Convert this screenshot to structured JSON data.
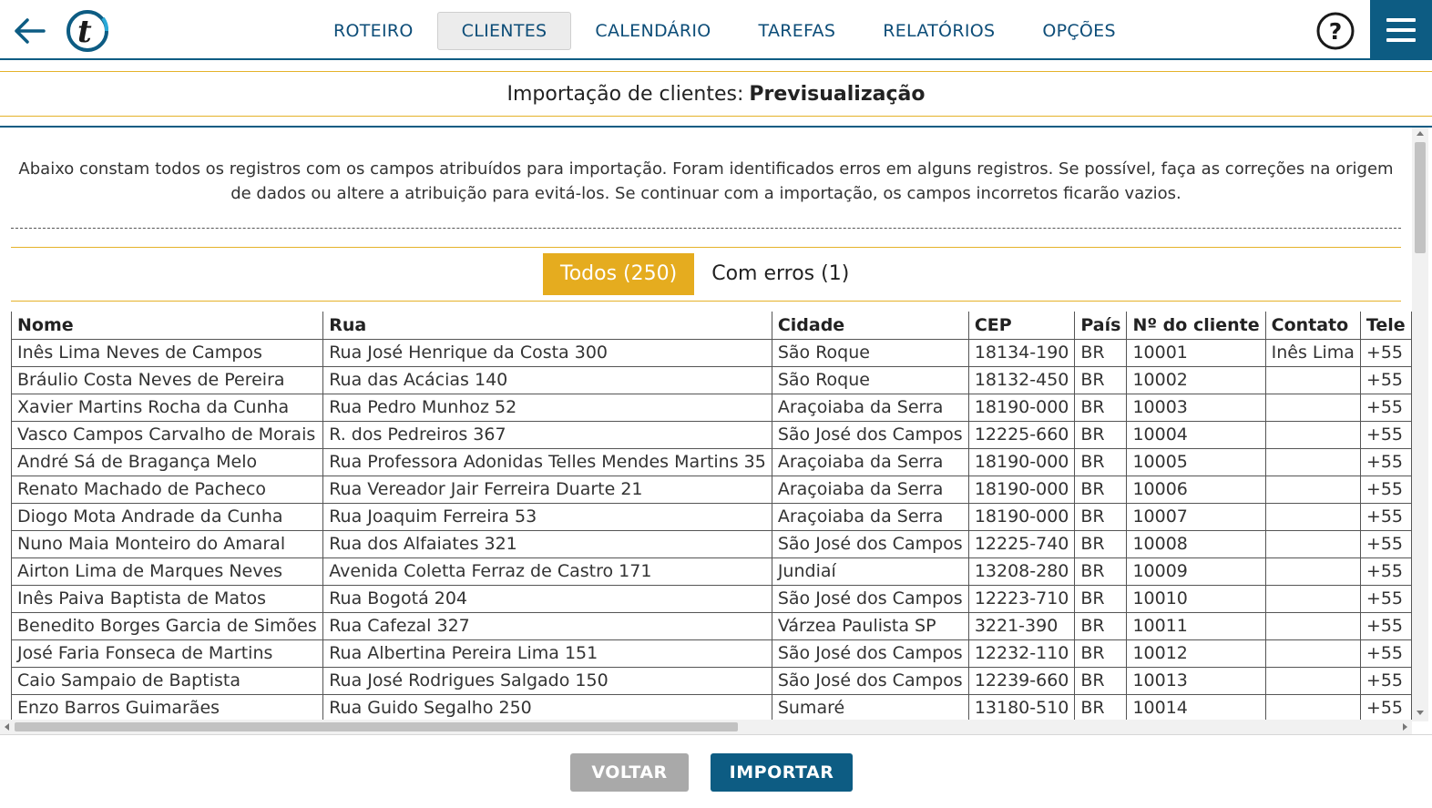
{
  "nav": {
    "back_icon": "arrow-left-icon",
    "logo_letter": "t",
    "items": [
      {
        "label": "ROTEIRO",
        "active": false
      },
      {
        "label": "CLIENTES",
        "active": true
      },
      {
        "label": "CALENDÁRIO",
        "active": false
      },
      {
        "label": "TAREFAS",
        "active": false
      },
      {
        "label": "RELATÓRIOS",
        "active": false
      },
      {
        "label": "OPÇÕES",
        "active": false
      }
    ],
    "help_label": "?",
    "menu_icon": "hamburger-menu-icon"
  },
  "page": {
    "title_prefix": "Importação de clientes:",
    "title_bold": "Previsualização",
    "intro": "Abaixo constam todos os registros com os campos atribuídos para importação. Foram identificados erros em alguns registros. Se possível, faça as correções na origem de dados ou altere a atribuição para evitá-los. Se continuar com a importação, os campos incorretos ficarão vazios."
  },
  "filters": {
    "all_label": "Todos (250)",
    "errors_label": "Com erros (1)"
  },
  "table": {
    "columns": [
      "Nome",
      "Rua",
      "Cidade",
      "CEP",
      "País",
      "Nº do cliente",
      "Contato",
      "Tele"
    ],
    "rows": [
      [
        "Inês Lima Neves de Campos",
        "Rua José Henrique da Costa 300",
        "São Roque",
        "18134-190",
        "BR",
        "10001",
        "Inês Lima",
        "+55"
      ],
      [
        "Bráulio Costa Neves de Pereira",
        "Rua das Acácias 140",
        "São Roque",
        "18132-450",
        "BR",
        "10002",
        "",
        "+55"
      ],
      [
        "Xavier Martins Rocha da Cunha",
        "Rua Pedro Munhoz 52",
        "Araçoiaba da Serra",
        "18190-000",
        "BR",
        "10003",
        "",
        "+55"
      ],
      [
        "Vasco Campos Carvalho de Morais",
        "R. dos Pedreiros 367",
        "São José dos Campos",
        "12225-660",
        "BR",
        "10004",
        "",
        "+55"
      ],
      [
        "André Sá de Bragança Melo",
        "Rua Professora Adonidas Telles Mendes Martins 35",
        "Araçoiaba da Serra",
        "18190-000",
        "BR",
        "10005",
        "",
        "+55"
      ],
      [
        "Renato Machado de Pacheco",
        "Rua Vereador Jair Ferreira Duarte 21",
        "Araçoiaba da Serra",
        "18190-000",
        "BR",
        "10006",
        "",
        "+55"
      ],
      [
        "Diogo Mota Andrade da Cunha",
        "Rua Joaquim Ferreira 53",
        "Araçoiaba da Serra",
        "18190-000",
        "BR",
        "10007",
        "",
        "+55"
      ],
      [
        "Nuno Maia Monteiro do Amaral",
        "Rua dos Alfaiates 321",
        "São José dos Campos",
        "12225-740",
        "BR",
        "10008",
        "",
        "+55"
      ],
      [
        "Airton Lima de Marques Neves",
        "Avenida Coletta Ferraz de Castro 171",
        "Jundiaí",
        "13208-280",
        "BR",
        "10009",
        "",
        "+55"
      ],
      [
        "Inês Paiva Baptista de Matos",
        "Rua Bogotá 204",
        "São José dos Campos",
        "12223-710",
        "BR",
        "10010",
        "",
        "+55"
      ],
      [
        "Benedito Borges Garcia de Simões",
        "Rua Cafezal 327",
        "Várzea Paulista SP",
        "3221-390",
        "BR",
        "10011",
        "",
        "+55"
      ],
      [
        "José Faria Fonseca de Martins",
        "Rua Albertina Pereira Lima 151",
        "São José dos Campos",
        "12232-110",
        "BR",
        "10012",
        "",
        "+55"
      ],
      [
        "Caio Sampaio de Baptista",
        "Rua José Rodrigues Salgado 150",
        "São José dos Campos",
        "12239-660",
        "BR",
        "10013",
        "",
        "+55"
      ],
      [
        "Enzo Barros Guimarães",
        "Rua Guido Segalho 250",
        "Sumaré",
        "13180-510",
        "BR",
        "10014",
        "",
        "+55"
      ]
    ]
  },
  "footer": {
    "back_label": "VOLTAR",
    "import_label": "IMPORTAR"
  },
  "colors": {
    "primary": "#0d5c83",
    "accent": "#e5ac1f",
    "nav_text": "#0d4d78",
    "disabled_button": "#a9a9a9"
  }
}
